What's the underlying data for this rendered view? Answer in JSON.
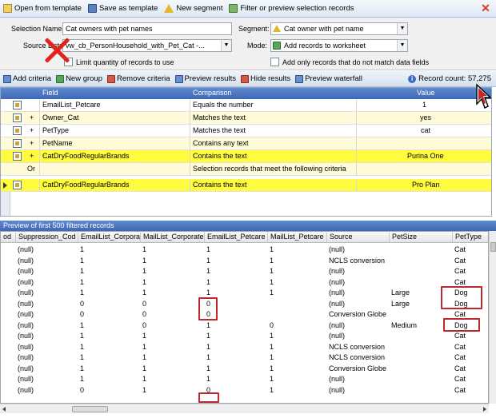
{
  "toolbar": {
    "open_template": "Open from template",
    "save_template": "Save as template",
    "new_segment": "New segment",
    "filter_preview": "Filter or preview selection records"
  },
  "form": {
    "selection_name_label": "Selection Name:",
    "selection_name_value": "Cat owners with pet names",
    "segment_label": "Segment:",
    "segment_value": "Cat owner with pet name",
    "source_list_label": "Source List:",
    "source_list_value": "vw_cb_PersonHousehold_with_Pet_Cat -...",
    "mode_label": "Mode:",
    "mode_value": "Add records to worksheet",
    "limit_label": "Limit quantity of records to use",
    "add_only_label": "Add only records that do not match data fields"
  },
  "criteria_toolbar": {
    "add_criteria": "Add criteria",
    "new_group": "New group",
    "remove_criteria": "Remove criteria",
    "preview_results": "Preview results",
    "hide_results": "Hide results",
    "preview_waterfall": "Preview waterfall",
    "record_count": "Record count: 57,275"
  },
  "criteria": {
    "headers": [
      "Field",
      "Comparison",
      "Value"
    ],
    "rows": [
      {
        "prefix": "",
        "field": "EmailList_Petcare",
        "comparison": "Equals the number",
        "value": "1"
      },
      {
        "prefix": "+",
        "field": "Owner_Cat",
        "comparison": "Matches the text",
        "value": "yes"
      },
      {
        "prefix": "+",
        "field": "PetType",
        "comparison": "Matches the text",
        "value": "cat"
      },
      {
        "prefix": "+",
        "field": "PetName",
        "comparison": "Contains any text",
        "value": ""
      },
      {
        "prefix": "+",
        "field": "CatDryFoodRegularBrands",
        "comparison": "Contains the text",
        "value": "Purina One"
      },
      {
        "prefix": "Or",
        "field": "",
        "comparison": "Selection records that meet the following criteria",
        "value": ""
      },
      {
        "prefix": "",
        "field": "CatDryFoodRegularBrands",
        "comparison": "Contains the text",
        "value": "Pro Plan"
      }
    ]
  },
  "preview": {
    "title": "Preview of first 500 filtered records",
    "headers": [
      "od",
      "Suppression_Cod",
      "EmailList_Corpora",
      "MailList_Corporate",
      "EmailList_Petcare",
      "MailList_Petcare",
      "Source",
      "PetSize",
      "PetType"
    ],
    "rows": [
      [
        "",
        "(null)",
        "1",
        "1",
        "1",
        "1",
        "(null)",
        "",
        "Cat"
      ],
      [
        "",
        "(null)",
        "1",
        "1",
        "1",
        "1",
        "NCLS conversion",
        "",
        "Cat"
      ],
      [
        "",
        "(null)",
        "1",
        "1",
        "1",
        "1",
        "(null)",
        "",
        "Cat"
      ],
      [
        "",
        "(null)",
        "1",
        "1",
        "1",
        "1",
        "(null)",
        "",
        "Cat"
      ],
      [
        "",
        "(null)",
        "1",
        "1",
        "1",
        "1",
        "(null)",
        "Large",
        "Dog"
      ],
      [
        "",
        "(null)",
        "0",
        "0",
        "0",
        "",
        "(null)",
        "Large",
        "Dog"
      ],
      [
        "",
        "(null)",
        "0",
        "0",
        "0",
        "",
        "Conversion Globe",
        "",
        "Cat"
      ],
      [
        "",
        "(null)",
        "1",
        "0",
        "1",
        "0",
        "(null)",
        "Medium",
        "Dog"
      ],
      [
        "",
        "(null)",
        "1",
        "1",
        "1",
        "1",
        "(null)",
        "",
        "Cat"
      ],
      [
        "",
        "(null)",
        "1",
        "1",
        "1",
        "1",
        "NCLS conversion",
        "",
        "Cat"
      ],
      [
        "",
        "(null)",
        "1",
        "1",
        "1",
        "1",
        "NCLS conversion",
        "",
        "Cat"
      ],
      [
        "",
        "(null)",
        "1",
        "1",
        "1",
        "1",
        "Conversion Globe",
        "",
        "Cat"
      ],
      [
        "",
        "(null)",
        "1",
        "1",
        "1",
        "1",
        "(null)",
        "",
        "Cat"
      ],
      [
        "",
        "(null)",
        "0",
        "1",
        "0",
        "1",
        "(null)",
        "",
        "Cat"
      ]
    ]
  }
}
